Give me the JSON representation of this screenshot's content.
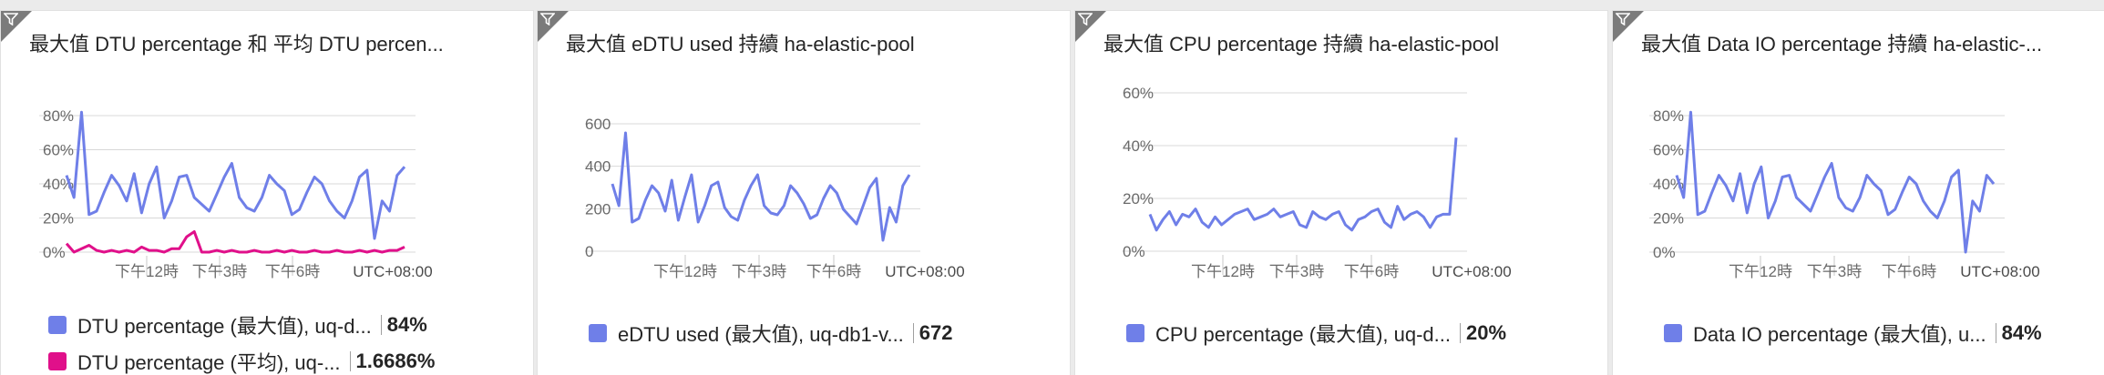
{
  "tiles": [
    {
      "title": "最大值 DTU percentage 和 平均 DTU percen...",
      "yticks": [
        "80%",
        "60%",
        "40%",
        "20%",
        "0%"
      ],
      "xticks": [
        "下午12時",
        "下午3時",
        "下午6時"
      ],
      "timezone": "UTC+08:00",
      "legend": [
        {
          "label": "DTU percentage (最大值), uq-d...",
          "value": "84%",
          "color": "#6f7fe8"
        },
        {
          "label": "DTU percentage (平均), uq-...",
          "value": "1.6686%",
          "color": "#e0108a"
        }
      ]
    },
    {
      "title": "最大值 eDTU used 持續 ha-elastic-pool",
      "yticks": [
        "600",
        "400",
        "200",
        "0"
      ],
      "xticks": [
        "下午12時",
        "下午3時",
        "下午6時"
      ],
      "timezone": "UTC+08:00",
      "legend": [
        {
          "label": "eDTU used (最大值), uq-db1-v...",
          "value": "672",
          "color": "#6f7fe8"
        }
      ]
    },
    {
      "title": "最大值 CPU percentage 持續 ha-elastic-pool",
      "yticks": [
        "60%",
        "40%",
        "20%",
        "0%"
      ],
      "xticks": [
        "下午12時",
        "下午3時",
        "下午6時"
      ],
      "timezone": "UTC+08:00",
      "legend": [
        {
          "label": "CPU percentage (最大值), uq-d...",
          "value": "20%",
          "color": "#6f7fe8"
        }
      ]
    },
    {
      "title": "最大值 Data IO percentage 持續 ha-elastic-...",
      "yticks": [
        "80%",
        "60%",
        "40%",
        "20%",
        "0%"
      ],
      "xticks": [
        "下午12時",
        "下午3時",
        "下午6時"
      ],
      "timezone": "UTC+08:00",
      "legend": [
        {
          "label": "Data IO percentage (最大值), u...",
          "value": "84%",
          "color": "#6f7fe8"
        }
      ]
    }
  ],
  "chart_data": [
    {
      "type": "line",
      "title": "最大值 DTU percentage 和 平均 DTU percen...",
      "ylim": [
        0,
        80
      ],
      "grid": true,
      "series": [
        {
          "name": "DTU percentage (最大值), uq-d...",
          "color": "#6f7fe8",
          "values": [
            45,
            32,
            82,
            22,
            24,
            35,
            45,
            39,
            30,
            46,
            23,
            40,
            50,
            20,
            30,
            44,
            45,
            32,
            28,
            24,
            34,
            44,
            52,
            32,
            26,
            24,
            32,
            45,
            40,
            36,
            22,
            25,
            35,
            44,
            40,
            30,
            24,
            20,
            30,
            44,
            48,
            8,
            30,
            24,
            45,
            50
          ]
        },
        {
          "name": "DTU percentage (平均), uq-...",
          "color": "#e0108a",
          "values": [
            5,
            0,
            2,
            4,
            1,
            0,
            1,
            0,
            1,
            0,
            3,
            1,
            1,
            0,
            2,
            2,
            9,
            12,
            0,
            0,
            1,
            0,
            1,
            0,
            0,
            1,
            0,
            0,
            1,
            0,
            1,
            0,
            0,
            1,
            0,
            0,
            1,
            0,
            0,
            1,
            0,
            1,
            0,
            1,
            1,
            3
          ]
        }
      ]
    },
    {
      "type": "line",
      "title": "最大值 eDTU used 持續 ha-elastic-pool",
      "ylim": [
        0,
        700
      ],
      "grid": true,
      "series": [
        {
          "name": "eDTU used (最大值), uq-db1-v...",
          "color": "#6f7fe8",
          "values": [
            370,
            250,
            650,
            160,
            180,
            280,
            360,
            320,
            220,
            390,
            170,
            300,
            420,
            160,
            250,
            360,
            380,
            240,
            190,
            170,
            280,
            360,
            420,
            250,
            210,
            200,
            250,
            360,
            320,
            260,
            180,
            200,
            290,
            360,
            320,
            230,
            190,
            150,
            250,
            350,
            400,
            60,
            240,
            160,
            360,
            420
          ]
        }
      ]
    },
    {
      "type": "line",
      "title": "最大值 CPU percentage 持續 ha-elastic-pool",
      "ylim": [
        0,
        60
      ],
      "grid": true,
      "series": [
        {
          "name": "CPU percentage (最大值), uq-d...",
          "color": "#6f7fe8",
          "values": [
            14,
            8,
            12,
            15,
            10,
            14,
            13,
            16,
            11,
            9,
            13,
            10,
            12,
            14,
            15,
            16,
            12,
            13,
            14,
            16,
            13,
            14,
            15,
            10,
            9,
            15,
            13,
            12,
            14,
            15,
            10,
            8,
            12,
            13,
            15,
            16,
            11,
            9,
            17,
            12,
            14,
            15,
            13,
            9,
            13,
            14,
            14,
            43
          ]
        }
      ]
    },
    {
      "type": "line",
      "title": "最大值 Data IO percentage 持續 ha-elastic-...",
      "ylim": [
        0,
        80
      ],
      "grid": true,
      "series": [
        {
          "name": "Data IO percentage (最大值), u...",
          "color": "#6f7fe8",
          "values": [
            45,
            32,
            82,
            22,
            24,
            35,
            45,
            39,
            30,
            46,
            23,
            40,
            50,
            20,
            30,
            44,
            45,
            32,
            28,
            24,
            34,
            44,
            52,
            32,
            26,
            24,
            32,
            45,
            40,
            36,
            22,
            25,
            35,
            44,
            40,
            30,
            24,
            20,
            30,
            44,
            48,
            0,
            30,
            24,
            45,
            40
          ]
        }
      ]
    }
  ]
}
